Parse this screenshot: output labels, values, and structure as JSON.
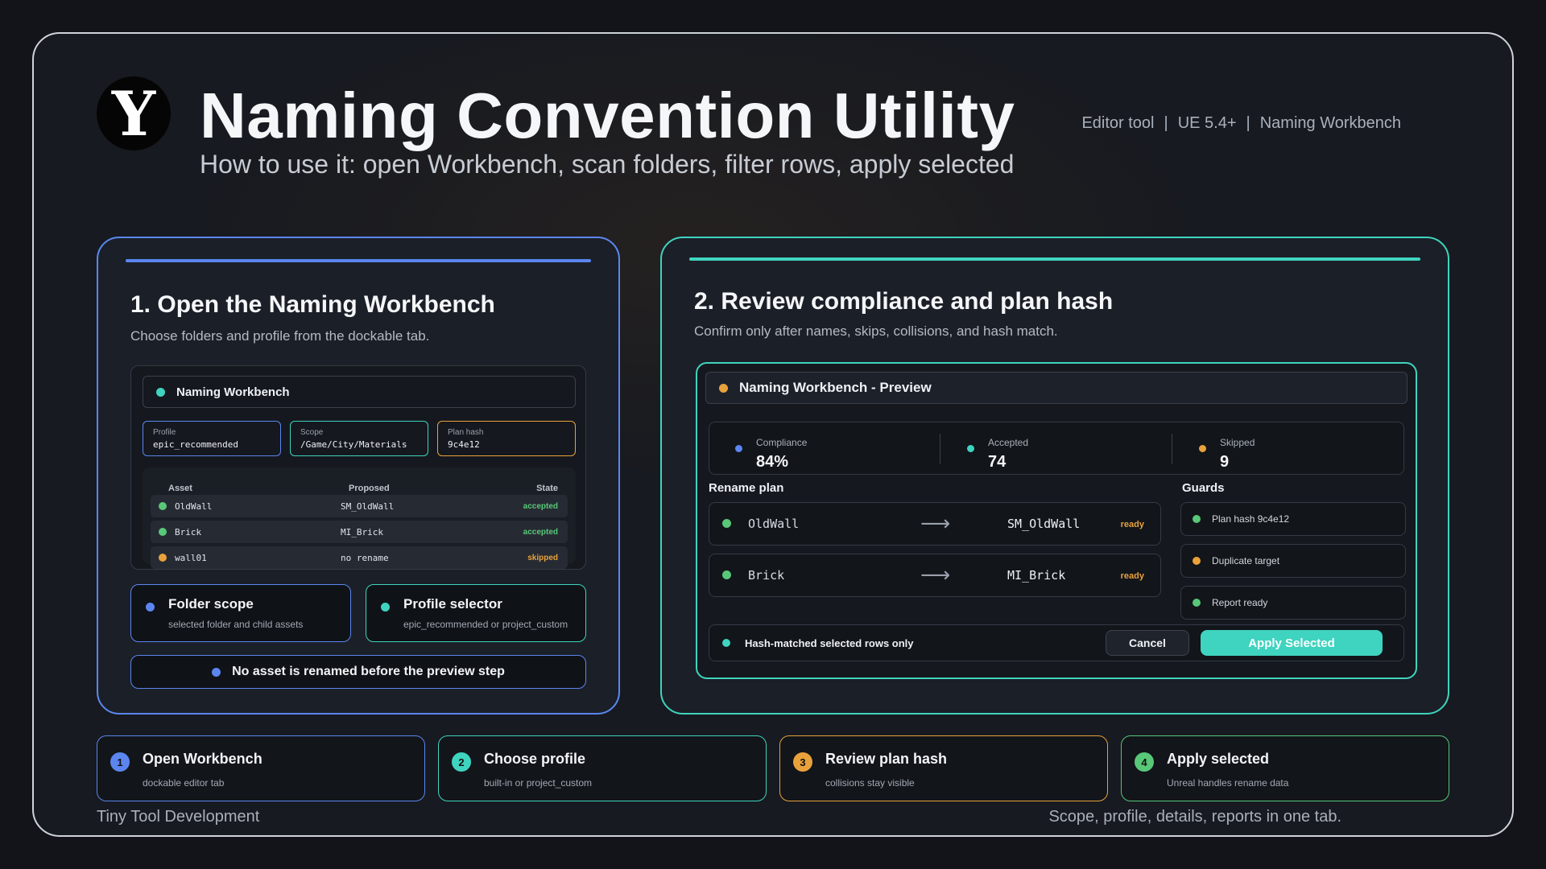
{
  "header": {
    "logo_letter": "Y",
    "title": "Naming Convention Utility",
    "subtitle": "How to use it: open Workbench, scan folders, filter rows, apply selected",
    "meta": [
      "Editor tool",
      "|",
      "UE 5.4+",
      "|",
      "Naming Workbench"
    ]
  },
  "colors": {
    "blue": "#5b86f0",
    "teal": "#3fd4bf",
    "orange": "#e9a23b",
    "green": "#58c878"
  },
  "step1": {
    "title": "1. Open the Naming Workbench",
    "subtitle": "Choose folders and profile from the dockable tab.",
    "workbench_title": "Naming Workbench",
    "fields": [
      {
        "label": "Profile",
        "value": "epic_recommended"
      },
      {
        "label": "Scope",
        "value": "/Game/City/Materials"
      },
      {
        "label": "Plan hash",
        "value": "9c4e12"
      }
    ],
    "table": {
      "headers": [
        "Asset",
        "Proposed",
        "State"
      ],
      "rows": [
        {
          "asset": "OldWall",
          "proposed": "SM_OldWall",
          "state": "accepted",
          "dot": "green"
        },
        {
          "asset": "Brick",
          "proposed": "MI_Brick",
          "state": "accepted",
          "dot": "green"
        },
        {
          "asset": "wall01",
          "proposed": "no rename",
          "state": "skipped",
          "dot": "orange"
        }
      ]
    },
    "cards": [
      {
        "title": "Folder scope",
        "sub": "selected folder and child assets"
      },
      {
        "title": "Profile selector",
        "sub": "epic_recommended or project_custom"
      }
    ],
    "banner": "No asset is renamed before the preview step"
  },
  "step2": {
    "title": "2. Review compliance and plan hash",
    "subtitle": "Confirm only after names, skips, collisions, and hash match.",
    "preview_title": "Naming Workbench - Preview",
    "stats": [
      {
        "label": "Compliance",
        "value": "84%",
        "dot": "blue"
      },
      {
        "label": "Accepted",
        "value": "74",
        "dot": "teal"
      },
      {
        "label": "Skipped",
        "value": "9",
        "dot": "orange"
      }
    ],
    "rename_plan_label": "Rename plan",
    "guards_label": "Guards",
    "renames": [
      {
        "from": "OldWall",
        "to": "SM_OldWall",
        "state": "ready"
      },
      {
        "from": "Brick",
        "to": "MI_Brick",
        "state": "ready"
      }
    ],
    "guards": [
      {
        "text": "Plan hash 9c4e12",
        "dot": "green"
      },
      {
        "text": "Duplicate target",
        "dot": "orange"
      },
      {
        "text": "Report ready",
        "dot": "green"
      }
    ],
    "action_label": "Hash-matched selected rows only",
    "cancel_label": "Cancel",
    "apply_label": "Apply Selected"
  },
  "steps": [
    {
      "num": "1",
      "title": "Open Workbench",
      "sub": "dockable editor tab"
    },
    {
      "num": "2",
      "title": "Choose profile",
      "sub": "built-in or project_custom"
    },
    {
      "num": "3",
      "title": "Review plan hash",
      "sub": "collisions stay visible"
    },
    {
      "num": "4",
      "title": "Apply selected",
      "sub": "Unreal handles rename data"
    }
  ],
  "footer": {
    "left": "Tiny Tool Development",
    "right": "Scope, profile, details, reports in one tab."
  }
}
